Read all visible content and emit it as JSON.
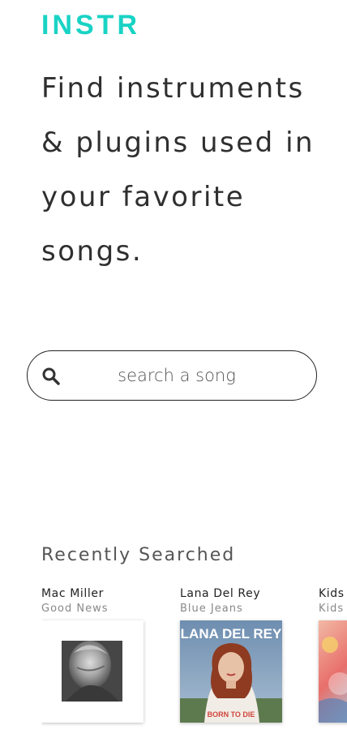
{
  "app": {
    "logo": "INSTR",
    "brand_color": "#19d3c5"
  },
  "hero": {
    "headline": "Find instruments & plugins used in your favorite songs."
  },
  "search": {
    "placeholder": "search a song",
    "icon": "search-icon"
  },
  "recent": {
    "title": "Recently Searched",
    "items": [
      {
        "artist": "Mac Miller",
        "song": "Good News",
        "cover_text": []
      },
      {
        "artist": "Lana Del Rey",
        "song": "Blue Jeans",
        "cover_text": [
          "LANA DEL REY",
          "BORN TO DIE"
        ]
      },
      {
        "artist": "Kids",
        "song": "Kids",
        "cover_text": []
      }
    ]
  }
}
